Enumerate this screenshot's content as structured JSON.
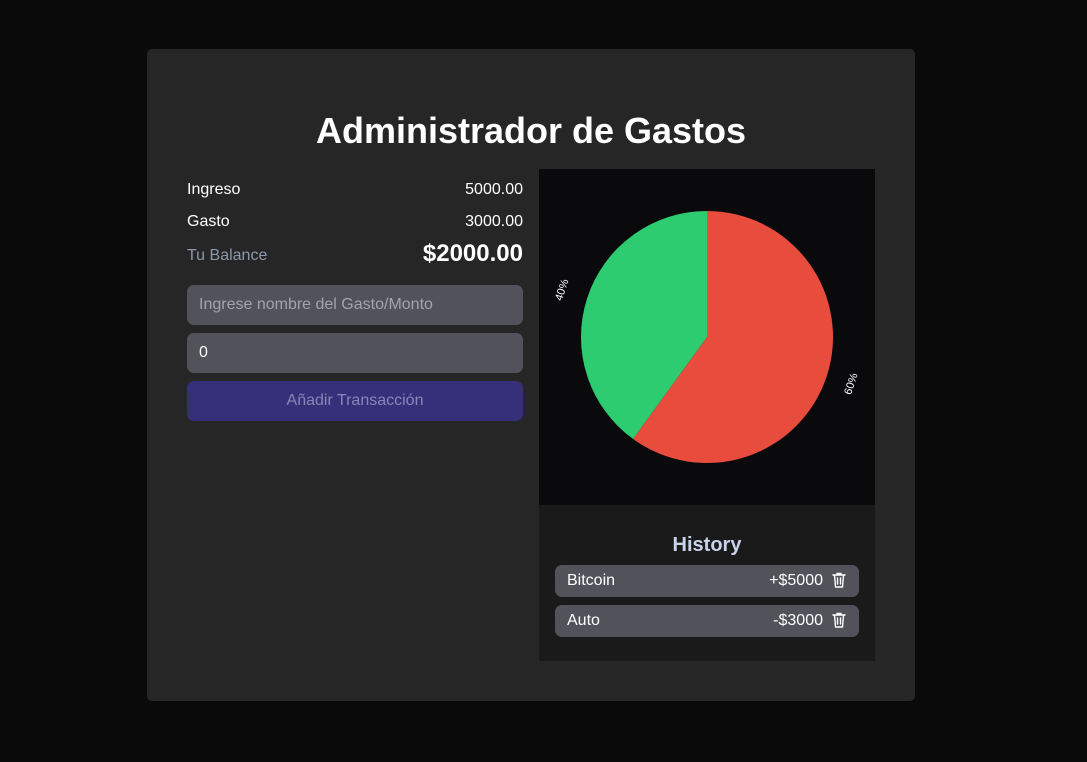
{
  "app": {
    "title": "Administrador de Gastos"
  },
  "summary": {
    "income_label": "Ingreso",
    "income_value": "5000.00",
    "expense_label": "Gasto",
    "expense_value": "3000.00",
    "balance_label": "Tu Balance",
    "balance_value": "$2000.00"
  },
  "form": {
    "name_placeholder": "Ingrese nombre del Gasto/Monto",
    "name_value": "",
    "amount_value": "0",
    "submit_label": "Añadir Transacción"
  },
  "chart_data": {
    "type": "pie",
    "slices": [
      {
        "label": "60%",
        "value": 60,
        "color": "#e74c3c"
      },
      {
        "label": "40%",
        "value": 40,
        "color": "#2ecc71"
      }
    ]
  },
  "history": {
    "title": "History",
    "items": [
      {
        "name": "Bitcoin",
        "amount": "+$5000",
        "icon": "trash-icon"
      },
      {
        "name": "Auto",
        "amount": "-$3000",
        "icon": "trash-icon"
      }
    ]
  },
  "colors": {
    "background": "#0a0a0a",
    "card": "#262626",
    "input": "#52525b",
    "button": "#36307a",
    "income_slice": "#e74c3c",
    "expense_slice": "#2ecc71"
  }
}
